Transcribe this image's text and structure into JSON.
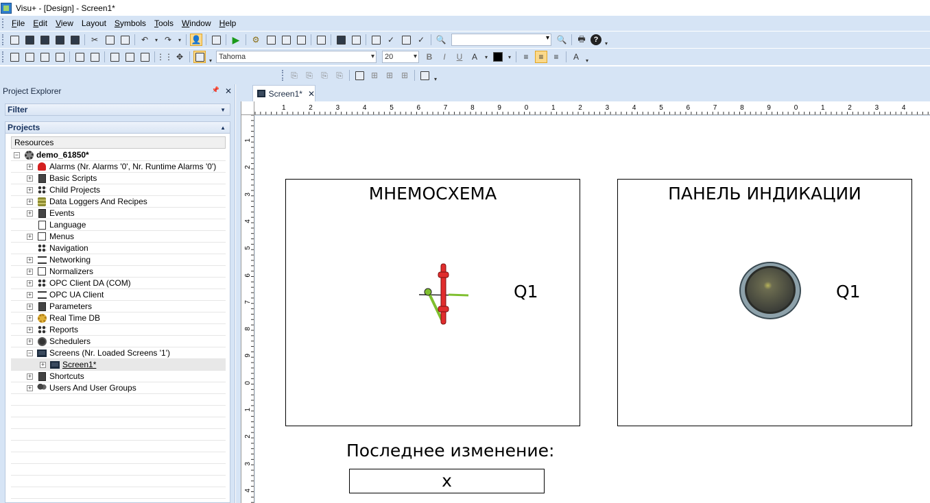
{
  "window": {
    "title": "Visu+ - [Design] - Screen1*"
  },
  "menu": [
    {
      "accel": "F",
      "rest": "ile"
    },
    {
      "accel": "E",
      "rest": "dit"
    },
    {
      "accel": "V",
      "rest": "iew"
    },
    {
      "accel": "",
      "rest": "Layout"
    },
    {
      "accel": "S",
      "rest": "ymbols"
    },
    {
      "accel": "T",
      "rest": "ools"
    },
    {
      "accel": "W",
      "rest": "indow"
    },
    {
      "accel": "H",
      "rest": "elp"
    }
  ],
  "format_toolbar": {
    "font": "Tahoma",
    "size": "20"
  },
  "explorer": {
    "title": "Project Explorer",
    "pin": "📌",
    "close": "✕",
    "filter_label": "Filter",
    "projects_label": "Projects",
    "resources_tab": "Resources",
    "tree": [
      {
        "label": "demo_61850*",
        "level": 0,
        "exp": "⊟",
        "icon": "gear",
        "bold": true
      },
      {
        "label": "Alarms (Nr. Alarms '0', Nr. Runtime Alarms '0')",
        "level": 1,
        "exp": "+",
        "icon": "bell"
      },
      {
        "label": "Basic Scripts",
        "level": 1,
        "exp": "+",
        "icon": "doc-dark"
      },
      {
        "label": "Child Projects",
        "level": 1,
        "exp": "+",
        "icon": "tree"
      },
      {
        "label": "Data Loggers And Recipes",
        "level": 1,
        "exp": "+",
        "icon": "db"
      },
      {
        "label": "Events",
        "level": 1,
        "exp": "+",
        "icon": "doc-dark"
      },
      {
        "label": "Language",
        "level": 1,
        "exp": "",
        "icon": "doc"
      },
      {
        "label": "Menus",
        "level": 1,
        "exp": "+",
        "icon": "small"
      },
      {
        "label": "Navigation",
        "level": 1,
        "exp": "",
        "icon": "tree"
      },
      {
        "label": "Networking",
        "level": 1,
        "exp": "+",
        "icon": "net"
      },
      {
        "label": "Normalizers",
        "level": 1,
        "exp": "+",
        "icon": "small"
      },
      {
        "label": "OPC Client DA (COM)",
        "level": 1,
        "exp": "+",
        "icon": "tree"
      },
      {
        "label": "OPC UA Client",
        "level": 1,
        "exp": "+",
        "icon": "net"
      },
      {
        "label": "Parameters",
        "level": 1,
        "exp": "+",
        "icon": "doc-dark"
      },
      {
        "label": "Real Time DB",
        "level": 1,
        "exp": "+",
        "icon": "rgear"
      },
      {
        "label": "Reports",
        "level": 1,
        "exp": "+",
        "icon": "tree"
      },
      {
        "label": "Schedulers",
        "level": 1,
        "exp": "+",
        "icon": "clock"
      },
      {
        "label": "Screens (Nr. Loaded Screens '1')",
        "level": 1,
        "exp": "−",
        "icon": "screen"
      },
      {
        "label": "Screen1*",
        "level": 2,
        "exp": "+",
        "icon": "screen",
        "selected": true,
        "underlined": true
      },
      {
        "label": "Shortcuts",
        "level": 1,
        "exp": "+",
        "icon": "doc-dark"
      },
      {
        "label": "Users And User Groups",
        "level": 1,
        "exp": "+",
        "icon": "people"
      }
    ],
    "empty_rows": 10
  },
  "doc_tab": {
    "label": "Screen1*",
    "close": "✕"
  },
  "ruler": {
    "top": [
      "1",
      "2",
      "3",
      "4",
      "5",
      "6",
      "7",
      "8",
      "9",
      "0",
      "1",
      "2",
      "3",
      "4",
      "5",
      "6",
      "7",
      "8",
      "9",
      "0",
      "1",
      "2",
      "3",
      "4"
    ],
    "left": [
      "1",
      "2",
      "3",
      "4",
      "5",
      "6",
      "7",
      "8",
      "9",
      "0",
      "1",
      "2",
      "3",
      "4"
    ]
  },
  "screen": {
    "mnemo_title": "МНЕМОСХЕМА",
    "panel_title": "ПАНЕЛЬ ИНДИКАЦИИ",
    "mnemo_q1": "Q1",
    "panel_q1": "Q1",
    "last_change_label": "Последнее изменение:",
    "last_change_value": "x"
  },
  "colors": {
    "chrome": "#d6e4f5",
    "breaker_red": "#e02c2c",
    "breaker_green": "#7fbf2f",
    "lamp": "#4a4e48"
  }
}
